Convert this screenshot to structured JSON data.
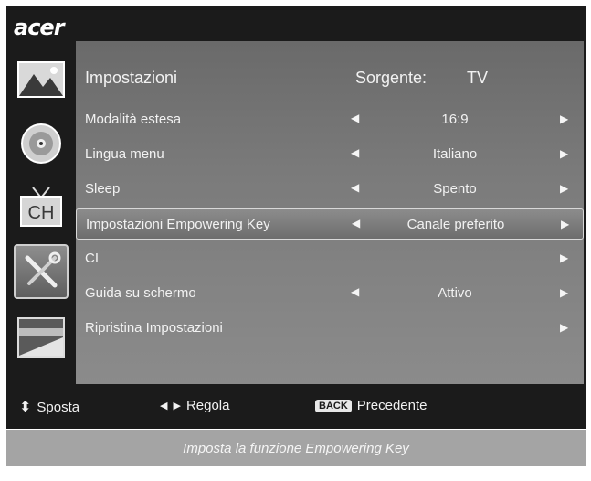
{
  "brand": "acer",
  "sidebar": {
    "items": [
      {
        "icon": "picture-icon"
      },
      {
        "icon": "disc-audio-icon"
      },
      {
        "icon": "tv-channel-icon",
        "label": "CH"
      },
      {
        "icon": "tools-settings-icon",
        "selected": true
      },
      {
        "icon": "screen-layers-icon"
      }
    ]
  },
  "panel": {
    "title": "Impostazioni",
    "source_label": "Sorgente:",
    "source_value": "TV",
    "rows": [
      {
        "label": "Modalità estesa",
        "value": "16:9",
        "left_arrow": true,
        "right_arrow": true
      },
      {
        "label": "Lingua menu",
        "value": "Italiano",
        "left_arrow": true,
        "right_arrow": true
      },
      {
        "label": "Sleep",
        "value": "Spento",
        "left_arrow": true,
        "right_arrow": true
      },
      {
        "label": "Impostazioni Empowering Key",
        "value": "Canale preferito",
        "left_arrow": true,
        "right_arrow": true,
        "selected": true
      },
      {
        "label": "CI",
        "value": "",
        "left_arrow": false,
        "right_arrow": true
      },
      {
        "label": "Guida su schermo",
        "value": "Attivo",
        "left_arrow": true,
        "right_arrow": true
      },
      {
        "label": "Ripristina Impostazioni",
        "value": "",
        "left_arrow": false,
        "right_arrow": true
      }
    ]
  },
  "hints": {
    "move": "Sposta",
    "adjust": "Regola",
    "back_key": "BACK",
    "back": "Precedente"
  },
  "status_text": "Imposta la funzione Empowering Key",
  "glyphs": {
    "left": "◀",
    "right": "▶",
    "updown": "⬍"
  }
}
